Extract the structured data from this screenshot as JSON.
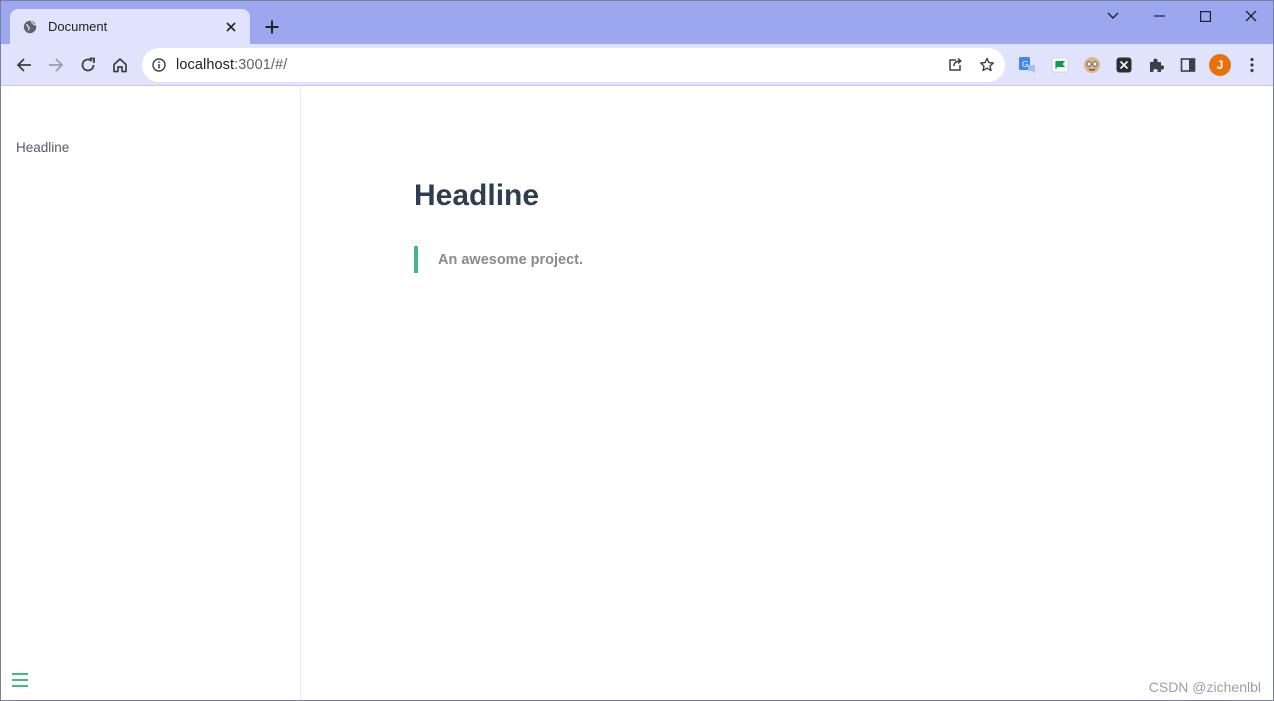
{
  "browser": {
    "tab": {
      "title": "Document"
    },
    "address_bar": {
      "host": "localhost",
      "path": ":3001/#/"
    },
    "profile_initial": "J",
    "colors": {
      "frame": "#9ba8f0",
      "toolbar": "#dfe3fb",
      "avatar": "#e8710a"
    }
  },
  "sidebar": {
    "items": [
      {
        "label": "Headline"
      }
    ]
  },
  "main": {
    "title": "Headline",
    "blockquote": "An awesome project."
  },
  "theme": {
    "accent": "#42b983",
    "heading": "#2c3e50"
  },
  "watermark": "CSDN @zichenlbl"
}
